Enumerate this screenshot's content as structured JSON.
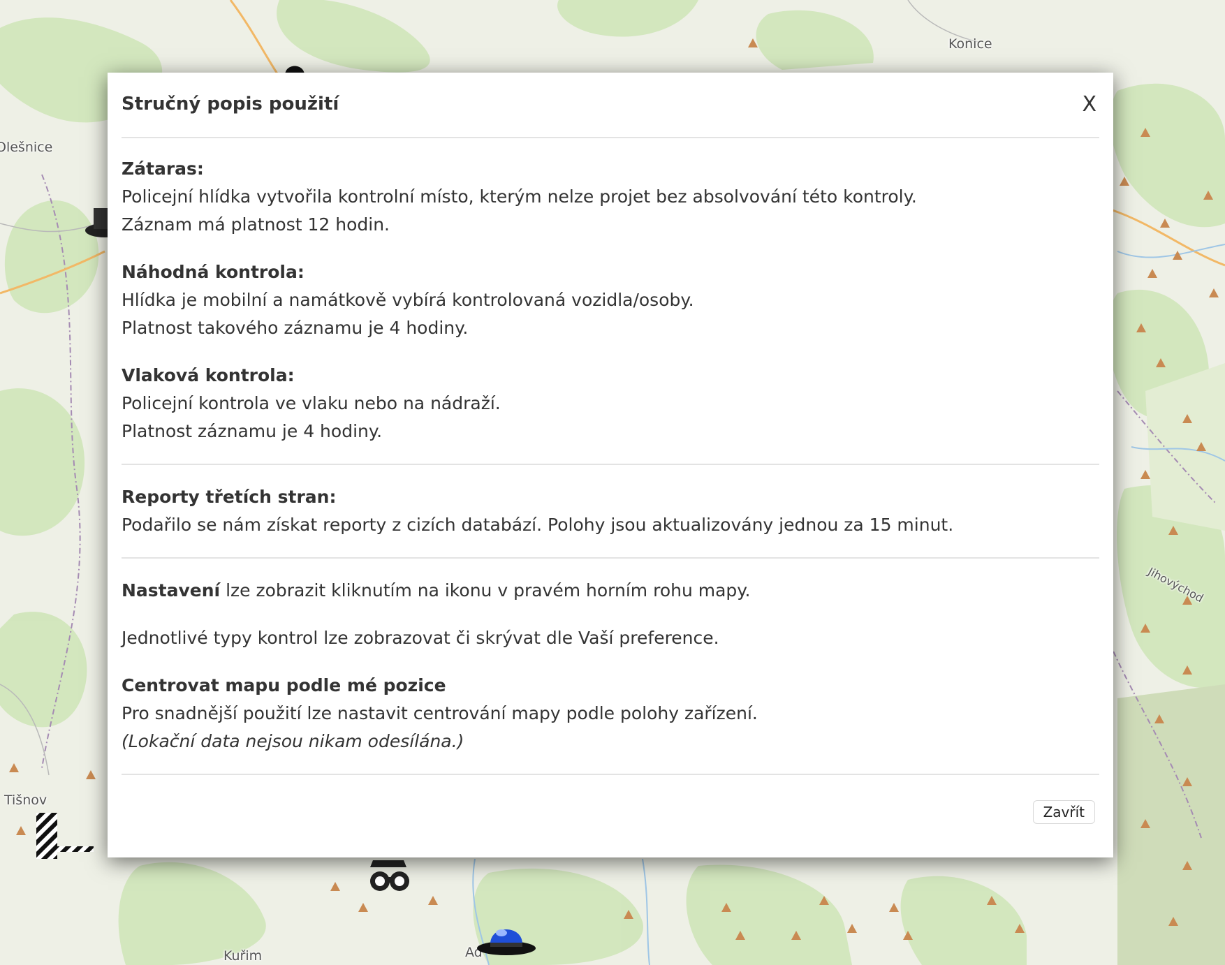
{
  "map": {
    "labels": {
      "konice": "Konice",
      "olesnice": "Olešnice",
      "tisnov": "Tišnov",
      "kurim": "Kuřim",
      "adamov": "Ad",
      "jihovychod": "Jihovýchod"
    },
    "colors": {
      "land": "#eef0e6",
      "forest": "#cfe5b9",
      "meadow": "#e3edd3",
      "road": "#f2b866",
      "water": "#9fc6e6",
      "border": "#a58bb3",
      "peak": "#c98a52"
    }
  },
  "modal": {
    "title": "Stručný popis použití",
    "close_x": "X",
    "sections": [
      {
        "items": [
          {
            "title": "Zátaras:",
            "lines": [
              "Policejní hlídka vytvořila kontrolní místo, kterým nelze projet bez absolvování této kontroly.",
              "Záznam má platnost 12 hodin."
            ]
          },
          {
            "title": "Náhodná kontrola:",
            "lines": [
              "Hlídka je mobilní a namátkově vybírá kontrolovaná vozidla/osoby.",
              "Platnost takového záznamu je 4 hodiny."
            ]
          },
          {
            "title": "Vlaková kontrola:",
            "lines": [
              "Policejní kontrola ve vlaku nebo na nádraží.",
              "Platnost záznamu je 4 hodiny."
            ]
          }
        ]
      },
      {
        "items": [
          {
            "title": "Reporty třetích stran:",
            "lines": [
              "Podařilo se nám získat reporty z cizích databází. Polohy jsou aktualizovány jednou za 15 minut."
            ]
          }
        ]
      }
    ],
    "settings": {
      "bold": "Nastavení",
      "rest": " lze zobrazit kliknutím na ikonu v pravém horním rohu mapy.",
      "types": "Jednotlivé typy kontrol lze zobrazovat či skrývat dle Vaší preference.",
      "center_title": "Centrovat mapu podle mé pozice",
      "center_text": "Pro snadnější použití lze nastavit centrování mapy podle polohy zařízení.",
      "center_note": "(Lokační data nejsou nikam odesílána.)"
    },
    "footer": {
      "close_label": "Zavřít"
    }
  },
  "icons": [
    "roadblock-barrier-icon",
    "binoculars-patrol-icon",
    "police-beacon-icon",
    "police-cap-icon"
  ]
}
